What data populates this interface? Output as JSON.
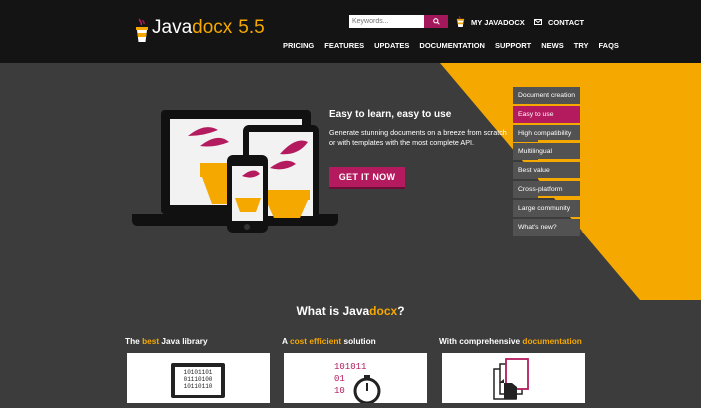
{
  "header": {
    "logo_prefix": "Java",
    "logo_accent": "docx",
    "logo_version": "5.5",
    "search": {
      "placeholder": "Keywords..."
    },
    "my_account_label": "MY JAVADOCX",
    "contact_label": "CONTACT",
    "nav": [
      "PRICING",
      "FEATURES",
      "UPDATES",
      "DOCUMENTATION",
      "SUPPORT",
      "NEWS",
      "TRY",
      "FAQS"
    ]
  },
  "hero": {
    "title": "Easy to learn, easy to use",
    "description": "Generate stunning documents on a breeze from scratch or with templates with the most complete API.",
    "cta_label": "GET IT NOW",
    "tabs": [
      {
        "label": "Document creation",
        "active": false
      },
      {
        "label": "Easy to use",
        "active": true
      },
      {
        "label": "High compatibility",
        "active": false
      },
      {
        "label": "Multilingual",
        "active": false
      },
      {
        "label": "Best value",
        "active": false
      },
      {
        "label": "Cross-platform",
        "active": false
      },
      {
        "label": "Large community",
        "active": false
      },
      {
        "label": "What's new?",
        "active": false
      }
    ]
  },
  "what": {
    "prefix": "What is Java",
    "accent": "docx",
    "suffix": "?",
    "columns": [
      {
        "pre": "The ",
        "accent": "best",
        "post": " Java library"
      },
      {
        "pre": "A ",
        "accent": "cost efficient",
        "post": " solution"
      },
      {
        "pre": "With comprehensive ",
        "accent": "documentation",
        "post": ""
      }
    ],
    "binary_left": [
      "10101101",
      "01110100",
      "10110110"
    ],
    "binary_mid": [
      "101011",
      "01",
      "10"
    ]
  },
  "colors": {
    "accent": "#f5a800",
    "brand": "#b31b5e",
    "header_bg": "#141414",
    "hero_bg": "#3c3c3c"
  }
}
